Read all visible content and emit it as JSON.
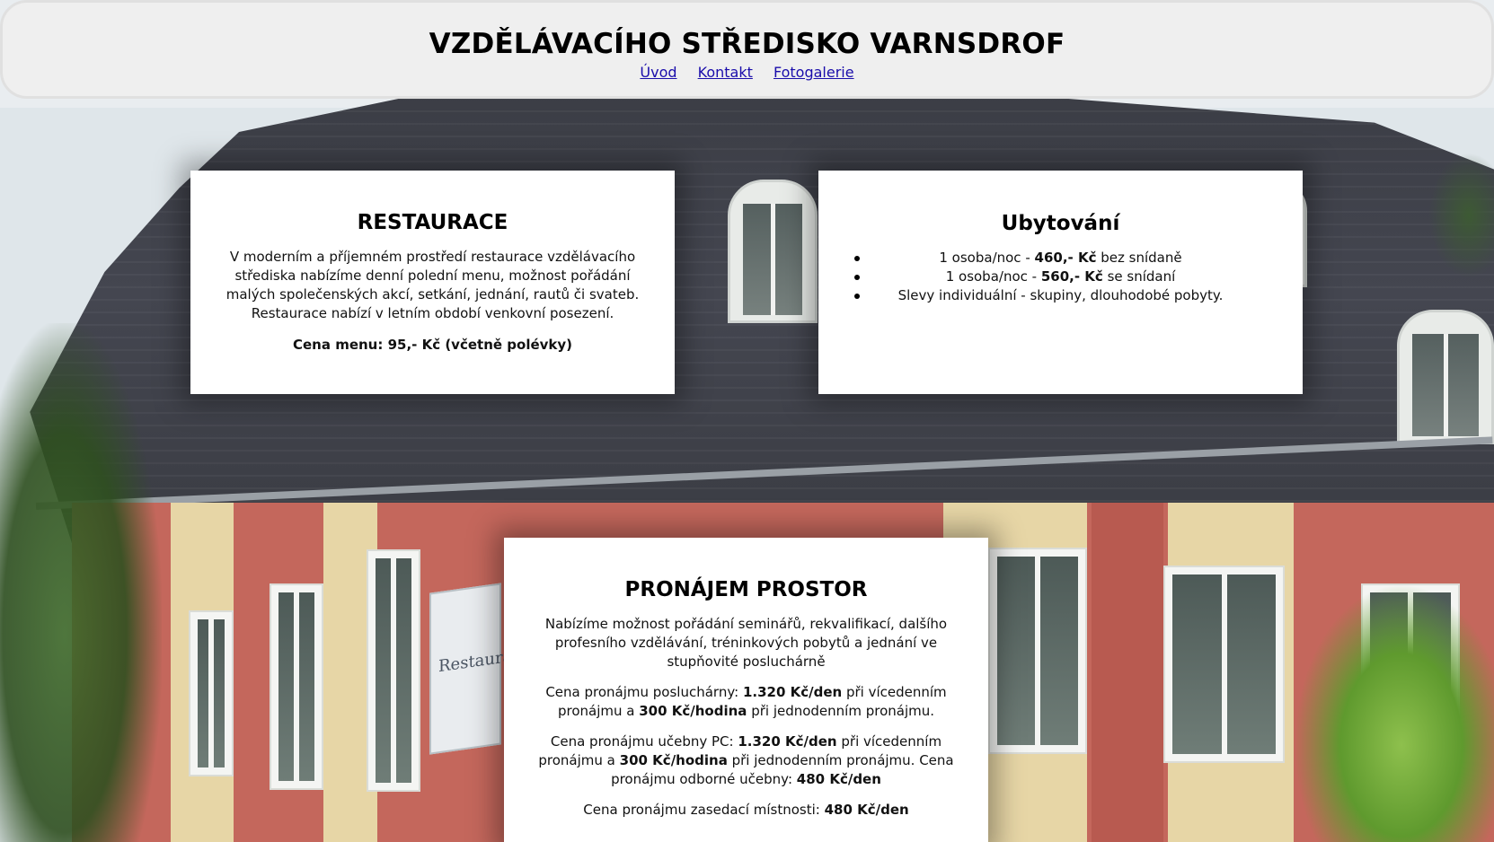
{
  "header": {
    "title": "VZDĚLÁVACÍHO STŘEDISKO VARNSDROF",
    "nav": [
      {
        "label": "Úvod"
      },
      {
        "label": "Kontakt"
      },
      {
        "label": "Fotogalerie"
      }
    ]
  },
  "background": {
    "sign_text": "Restaurace"
  },
  "restaurace": {
    "title": "RESTAURACE",
    "description": "V moderním a příjemném prostředí restaurace vzdělávacího střediska nabízíme denní polední menu, možnost pořádání malých společenských akcí, setkání, jednání, rautů či svateb. Restaurace nabízí v letním období venkovní posezení.",
    "price": "Cena menu: 95,- Kč (včetně polévky)"
  },
  "ubytovani": {
    "title": "Ubytování",
    "items": [
      {
        "pre": "1 osoba/noc - ",
        "bold": "460,- Kč",
        "post": " bez snídaně"
      },
      {
        "pre": "1 osoba/noc - ",
        "bold": "560,- Kč",
        "post": " se snídaní"
      },
      {
        "pre": "Slevy individuální - skupiny, dlouhodobé pobyty.",
        "bold": "",
        "post": ""
      }
    ]
  },
  "pronajem": {
    "title": "PRONÁJEM PROSTOR",
    "intro": "Nabízíme možnost pořádání seminářů, rekvalifikací, dalšího profesního vzdělávání, tréninkových pobytů a jednání ve stupňovité posluchárně",
    "posluchar": {
      "t1": "Cena pronájmu posluchárny: ",
      "b1": "1.320 Kč/den",
      "t2": " při vícedenním pronájmu a ",
      "b2": "300 Kč/hodina",
      "t3": " při jednodenním pronájmu."
    },
    "ucebna": {
      "t1": "Cena pronájmu učebny PC: ",
      "b1": "1.320 Kč/den",
      "t2": " při vícedenním pronájmu a ",
      "b2": "300 Kč/hodina",
      "t3": " při jednodenním pronájmu. Cena pronájmu odborné učebny: ",
      "b3": "480 Kč/den"
    },
    "zasedaci": {
      "t1": "Cena pronájmu zasedací místnosti: ",
      "b1": "480 Kč/den"
    }
  }
}
